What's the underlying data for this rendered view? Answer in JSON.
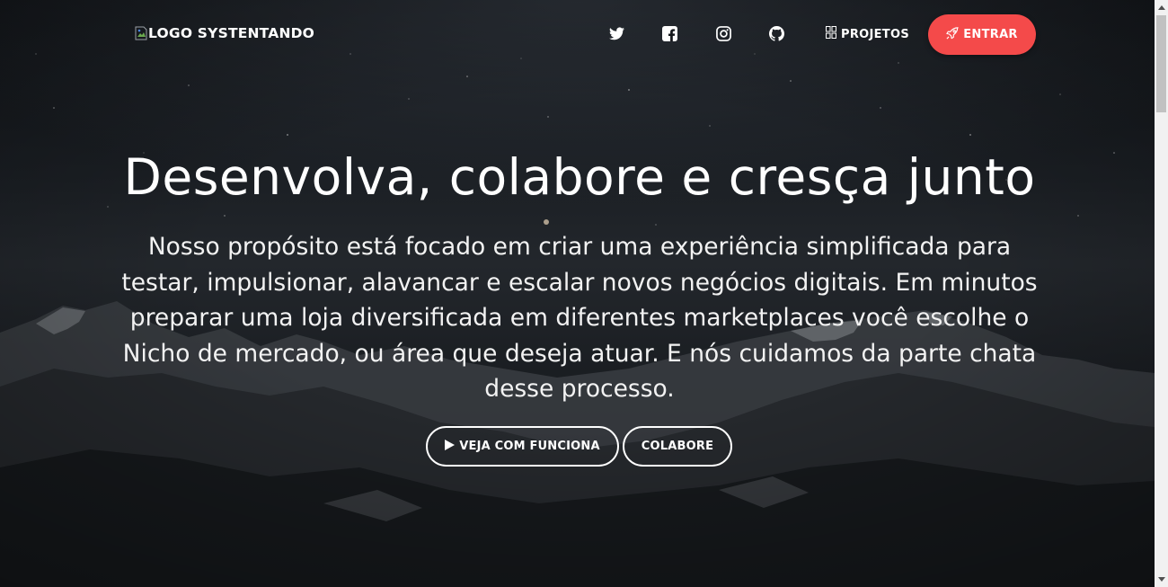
{
  "nav": {
    "logo_alt": "LOGO SYSTENTANDO",
    "social_icons": [
      "twitter-icon",
      "facebook-icon",
      "instagram-icon",
      "github-icon"
    ],
    "projetos_label": "PROJETOS",
    "entrar_label": "ENTRAR"
  },
  "hero": {
    "title": "Desenvolva, colabore e cresça junto",
    "description": "Nosso propósito está focado em criar uma experiência simplificada para testar, impulsionar, alavancar e escalar novos negócios digitais. Em minutos preparar uma loja diversificada em diferentes marketplaces você escolhe o Nicho de mercado, ou área que deseja atuar. E nós cuidamos da parte chata desse processo.",
    "primary_button": "VEJA COM FUNCIONA",
    "secondary_button": "COLABORE"
  },
  "colors": {
    "accent": "#f44a4a",
    "background": "#0d1014",
    "text": "#ffffff"
  }
}
